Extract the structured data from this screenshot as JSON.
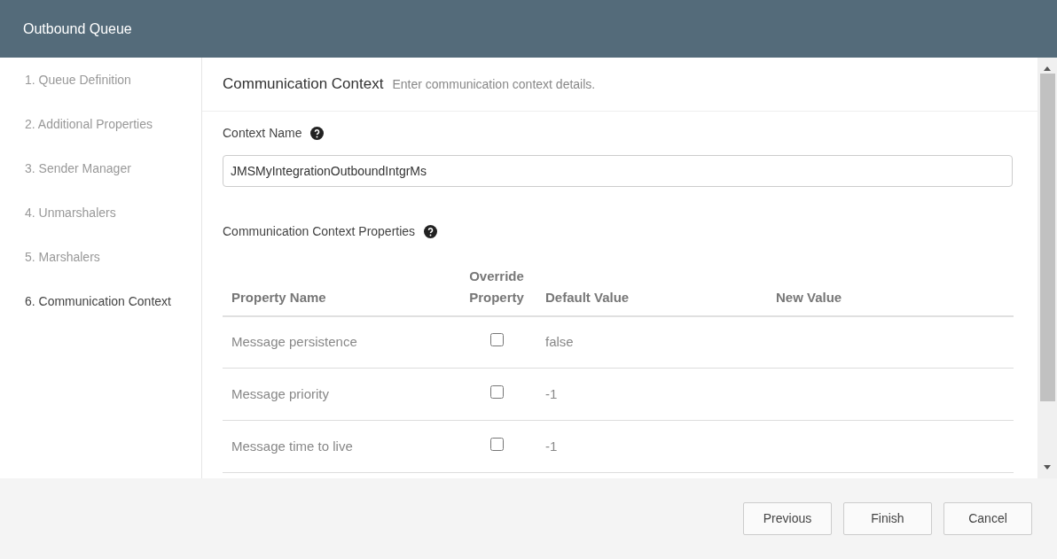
{
  "window": {
    "title": "Outbound Queue"
  },
  "steps": [
    {
      "label": "1. Queue Definition",
      "selected": false
    },
    {
      "label": "2. Additional Properties",
      "selected": false
    },
    {
      "label": "3. Sender Manager",
      "selected": false
    },
    {
      "label": "4. Unmarshalers",
      "selected": false
    },
    {
      "label": "5. Marshalers",
      "selected": false
    },
    {
      "label": "6. Communication Context",
      "selected": true
    }
  ],
  "section": {
    "title": "Communication Context",
    "subtitle": "Enter communication context details."
  },
  "context_name": {
    "label": "Context Name",
    "value": "JMSMyIntegrationOutboundIntgrMs"
  },
  "properties": {
    "label": "Communication Context Properties",
    "columns": [
      "Property Name",
      "Override Property",
      "Default Value",
      "New Value"
    ],
    "rows": [
      {
        "name": "Message persistence",
        "checked": false,
        "default": "false"
      },
      {
        "name": "Message priority",
        "checked": false,
        "default": "-1"
      },
      {
        "name": "Message time to live",
        "checked": false,
        "default": "-1"
      }
    ]
  },
  "buttons": [
    "Previous",
    "Finish",
    "Cancel"
  ]
}
